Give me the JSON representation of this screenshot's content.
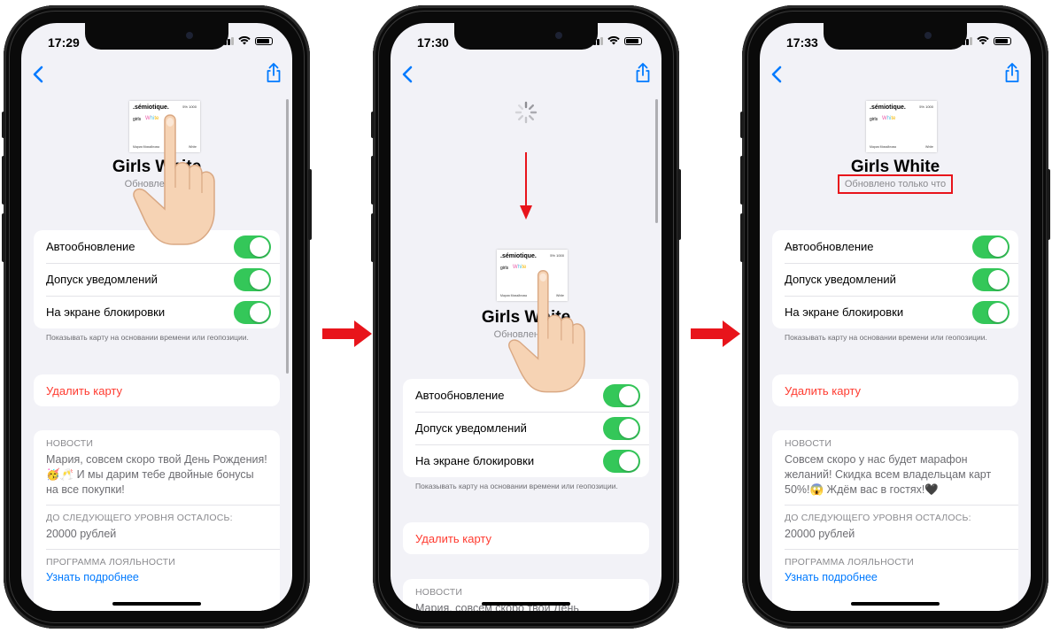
{
  "frames": [
    {
      "time": "17:29",
      "title": "Girls White",
      "subtitle": "Обновлено 20",
      "toggles": [
        "Автообновление",
        "Допуск уведомлений",
        "На экране блокировки"
      ],
      "footnote": "Показывать карту на основании времени или геопозиции.",
      "delete_label": "Удалить карту",
      "news_header": "НОВОСТИ",
      "news_text": "Мария, совсем скоро твой День Рождения! 🥳🥂 И мы дарим тебе двойные бонусы на все покупки!",
      "level_header": "ДО СЛЕДУЮЩЕГО УРОВНЯ ОСТАЛОСЬ:",
      "level_value": "20000 рублей",
      "loyalty_header": "ПРОГРАММА ЛОЯЛЬНОСТИ",
      "loyalty_link": "Узнать подробнее"
    },
    {
      "time": "17:30",
      "title": "Girls White",
      "subtitle": "Обновлено 20",
      "toggles": [
        "Автообновление",
        "Допуск уведомлений",
        "На экране блокировки"
      ],
      "footnote": "Показывать карту на основании времени или геопозиции.",
      "delete_label": "Удалить карту",
      "news_header": "НОВОСТИ",
      "news_text": "Мария, совсем скоро твой День"
    },
    {
      "time": "17:33",
      "title": "Girls White",
      "subtitle": "Обновлено только что",
      "toggles": [
        "Автообновление",
        "Допуск уведомлений",
        "На экране блокировки"
      ],
      "footnote": "Показывать карту на основании времени или геопозиции.",
      "delete_label": "Удалить карту",
      "news_header": "НОВОСТИ",
      "news_text": "Совсем скоро у нас будет марафон желаний! Скидка всем владельцам карт 50%!😱 Ждём вас в гостях!🖤",
      "level_header": "ДО СЛЕДУЮЩЕГО УРОВНЯ ОСТАЛОСЬ:",
      "level_value": "20000 рублей",
      "loyalty_header": "ПРОГРАММА ЛОЯЛЬНОСТИ",
      "loyalty_link": "Узнать подробнее"
    }
  ],
  "card_thumb": {
    "brand": ".sémiotique.",
    "number": "5% 1000",
    "girls": "girls",
    "colors": [
      "W",
      "hi",
      "te"
    ],
    "foot_left": "Мария Михайлова",
    "foot_right": "White"
  },
  "colors": {
    "accent_green": "#34c759",
    "delete_red": "#ff3b30",
    "link_blue": "#007aff",
    "arrow_red": "#e8141b"
  },
  "icons": [
    "back-chevron-icon",
    "share-icon",
    "signal-icon",
    "wifi-icon",
    "battery-icon",
    "spinner-icon",
    "tap-hand-icon",
    "right-arrow-icon",
    "down-arrow-icon"
  ]
}
